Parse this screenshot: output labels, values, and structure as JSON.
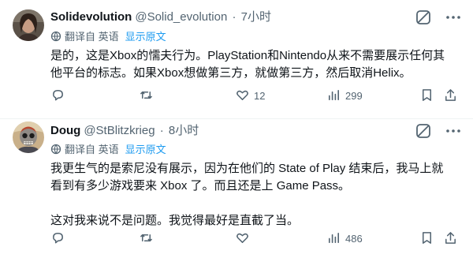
{
  "tweets": [
    {
      "name": "Solidevolution",
      "handle": "@Solid_evolution",
      "separator": "·",
      "time": "7小时",
      "translated_from": "翻译自 英语",
      "show_original": "显示原文",
      "text_lines": [
        "是的，这是Xbox的懦夫行为。PlayStation和Nintendo从来不需要展示任何其他平台的标志。如果Xbox想做第三方，就做第三方，然后取消Helix。"
      ],
      "replies": "",
      "retweets": "",
      "likes": "12",
      "views": "299"
    },
    {
      "name": "Doug",
      "handle": "@StBlitzkrieg",
      "separator": "·",
      "time": "8小时",
      "translated_from": "翻译自 英语",
      "show_original": "显示原文",
      "text_lines": [
        "我更生气的是索尼没有展示，因为在他们的 State of Play 结束后，我马上就看到有多少游戏要来 Xbox 了。而且还是上 Game Pass。",
        "这对我来说不是问题。我觉得最好是直截了当。"
      ],
      "replies": "",
      "retweets": "",
      "likes": "",
      "views": "486"
    }
  ],
  "colors": {
    "text": "#0f1419",
    "secondary": "#536471",
    "link": "#1d9bf0",
    "divider": "#eff3f4"
  },
  "icons": [
    "translate-icon",
    "grok-icon",
    "more-icon",
    "reply-icon",
    "retweet-icon",
    "like-icon",
    "views-icon",
    "bookmark-icon",
    "share-icon"
  ]
}
